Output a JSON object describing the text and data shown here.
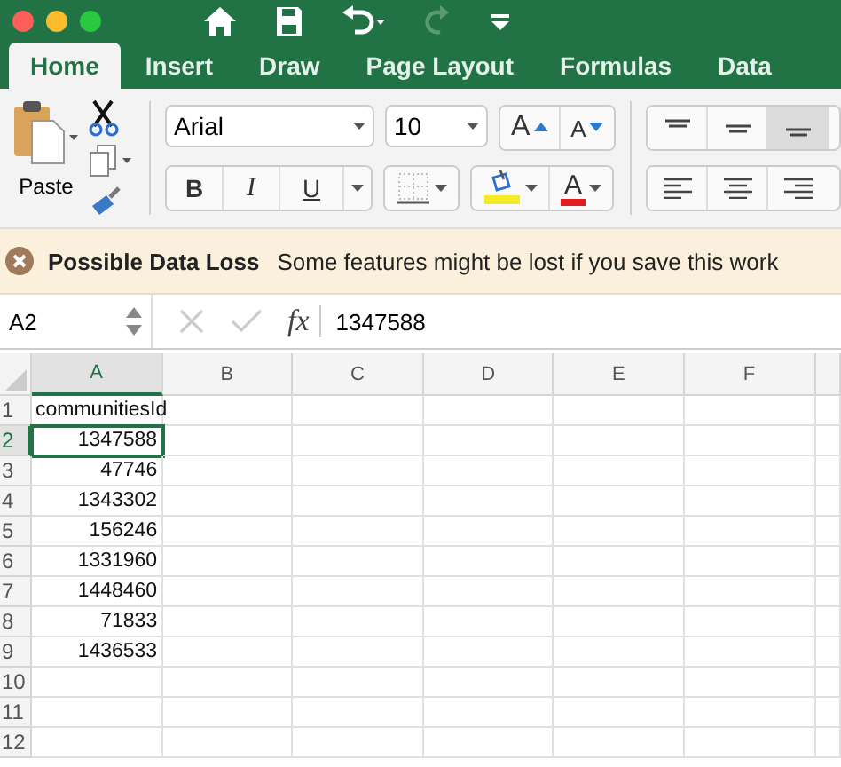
{
  "tabs": [
    {
      "label": "Home",
      "selected": true
    },
    {
      "label": "Insert",
      "selected": false
    },
    {
      "label": "Draw",
      "selected": false
    },
    {
      "label": "Page Layout",
      "selected": false
    },
    {
      "label": "Formulas",
      "selected": false
    },
    {
      "label": "Data",
      "selected": false
    }
  ],
  "ribbon": {
    "paste_label": "Paste",
    "font": "Arial",
    "size": "10",
    "grow_label": "A",
    "shrink_label": "A",
    "bold_label": "B",
    "italic_label": "I",
    "underline_label": "U",
    "font_color_label": "A"
  },
  "message_bar": {
    "title": "Possible Data Loss",
    "text": "Some features might be lost if you save this work"
  },
  "formula_bar": {
    "name_box": "A2",
    "fx": "fx",
    "value": "1347588"
  },
  "sheet": {
    "columns": [
      {
        "label": "A",
        "selected": true
      },
      {
        "label": "B",
        "selected": false
      },
      {
        "label": "C",
        "selected": false
      },
      {
        "label": "D",
        "selected": false
      },
      {
        "label": "E",
        "selected": false
      },
      {
        "label": "F",
        "selected": false
      }
    ],
    "rows": [
      {
        "number": "1",
        "selected": false,
        "cells": [
          {
            "value": "communitiesId",
            "kind": "text",
            "selected": false
          }
        ]
      },
      {
        "number": "2",
        "selected": true,
        "cells": [
          {
            "value": "1347588",
            "kind": "number",
            "selected": true
          }
        ]
      },
      {
        "number": "3",
        "selected": false,
        "cells": [
          {
            "value": "47746",
            "kind": "number",
            "selected": false
          }
        ]
      },
      {
        "number": "4",
        "selected": false,
        "cells": [
          {
            "value": "1343302",
            "kind": "number",
            "selected": false
          }
        ]
      },
      {
        "number": "5",
        "selected": false,
        "cells": [
          {
            "value": "156246",
            "kind": "number",
            "selected": false
          }
        ]
      },
      {
        "number": "6",
        "selected": false,
        "cells": [
          {
            "value": "1331960",
            "kind": "number",
            "selected": false
          }
        ]
      },
      {
        "number": "7",
        "selected": false,
        "cells": [
          {
            "value": "1448460",
            "kind": "number",
            "selected": false
          }
        ]
      },
      {
        "number": "8",
        "selected": false,
        "cells": [
          {
            "value": "71833",
            "kind": "number",
            "selected": false
          }
        ]
      },
      {
        "number": "9",
        "selected": false,
        "cells": [
          {
            "value": "1436533",
            "kind": "number",
            "selected": false
          }
        ]
      },
      {
        "number": "10",
        "selected": false,
        "cells": []
      },
      {
        "number": "11",
        "selected": false,
        "cells": []
      },
      {
        "number": "12",
        "selected": false,
        "cells": []
      }
    ]
  }
}
